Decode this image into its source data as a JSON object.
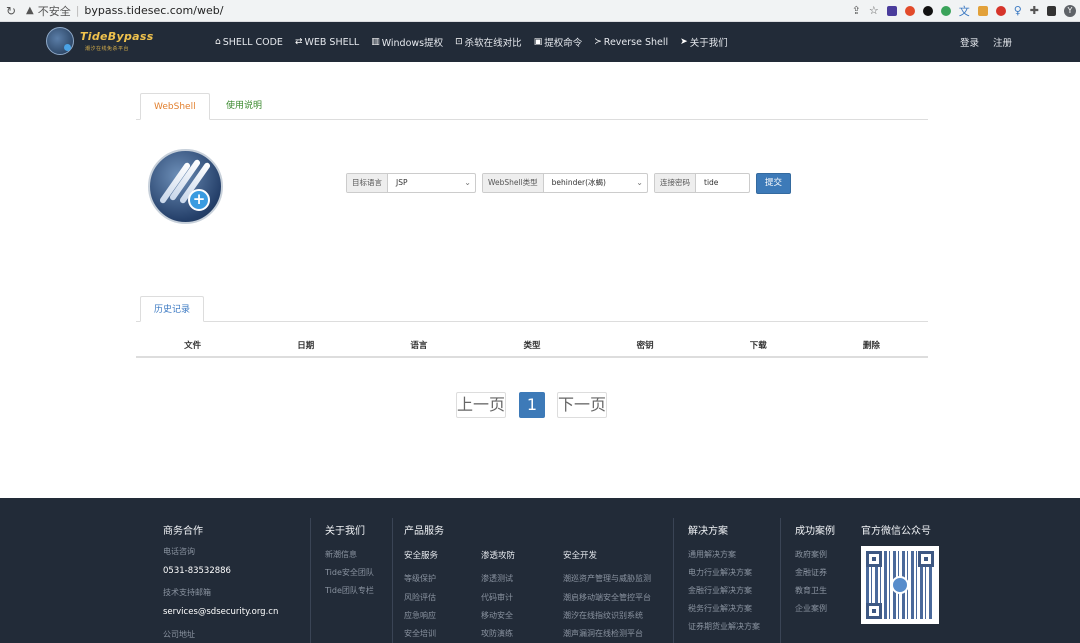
{
  "browser": {
    "insecure_label": "不安全",
    "url": "bypass.tidesec.com/web/",
    "avatar_letter": "Y",
    "ext_badge_count": "3"
  },
  "nav": {
    "brand": "TideBypass",
    "brand_sub": "潮汐在线免杀平台",
    "items": [
      {
        "label": "SHELL CODE",
        "icon": "home-icon"
      },
      {
        "label": "WEB SHELL",
        "icon": "swap-icon"
      },
      {
        "label": "Windows提权",
        "icon": "trash-icon"
      },
      {
        "label": "杀软在线对比",
        "icon": "compare-icon"
      },
      {
        "label": "提权命令",
        "icon": "terminal-box-icon"
      },
      {
        "label": "Reverse Shell",
        "icon": "prompt-icon"
      },
      {
        "label": "关于我们",
        "icon": "send-icon"
      }
    ],
    "login": "登录",
    "register": "注册"
  },
  "tabs": {
    "webshell": "WebShell",
    "usage": "使用说明"
  },
  "form": {
    "lang_label": "目标语言",
    "lang_value": "JSP",
    "type_label": "WebShell类型",
    "type_value": "behinder(冰蝎)",
    "pwd_label": "连接密码",
    "pwd_value": "tide",
    "submit": "提交"
  },
  "history": {
    "tab": "历史记录",
    "columns": [
      "文件",
      "日期",
      "语言",
      "类型",
      "密钥",
      "下载",
      "删除"
    ]
  },
  "pagination": {
    "prev": "上一页",
    "current": "1",
    "next": "下一页"
  },
  "footer": {
    "biz": {
      "title": "商务合作",
      "phone_label": "电话咨询",
      "phone": "0531-83532886",
      "email_label": "技术支持邮箱",
      "email": "services@sdsecurity.org.cn",
      "addr_label": "公司地址"
    },
    "about": {
      "title": "关于我们",
      "items": [
        "新潮信息",
        "Tide安全团队",
        "Tide团队专栏"
      ]
    },
    "products": {
      "title": "产品服务",
      "security_title": "安全服务",
      "security_items": [
        "等级保护",
        "风险评估",
        "应急响应",
        "安全培训"
      ],
      "pentest_title": "渗透攻防",
      "pentest_items": [
        "渗透测试",
        "代码审计",
        "移动安全",
        "攻防演练"
      ],
      "dev_title": "安全开发",
      "dev_items": [
        "潮巡资产管理与威胁监测",
        "潮启移动端安全管控平台",
        "潮汐在线指纹识别系统",
        "潮声漏洞在线检测平台"
      ]
    },
    "solutions": {
      "title": "解决方案",
      "items": [
        "通用解决方案",
        "电力行业解决方案",
        "金融行业解决方案",
        "税务行业解决方案",
        "证券期货业解决方案"
      ]
    },
    "cases": {
      "title": "成功案例",
      "items": [
        "政府案例",
        "金融证券",
        "教育卫生",
        "企业案例"
      ]
    },
    "wechat": {
      "title": "官方微信公众号"
    }
  }
}
